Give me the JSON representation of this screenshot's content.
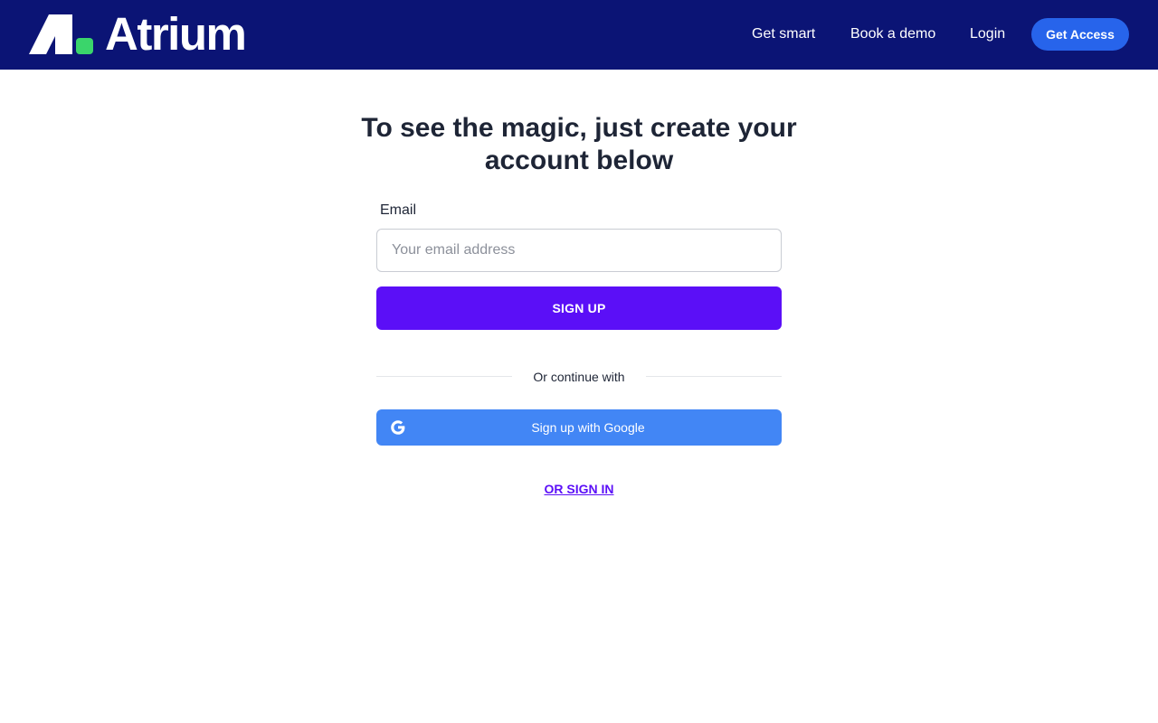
{
  "header": {
    "brand_name": "Atrium",
    "nav": {
      "get_smart": "Get smart",
      "book_demo": "Book a demo",
      "login": "Login"
    },
    "cta_label": "Get Access"
  },
  "main": {
    "headline": "To see the magic, just create your account below",
    "email_label": "Email",
    "email_placeholder": "Your email address",
    "email_value": "",
    "signup_label": "SIGN UP",
    "divider_text": "Or continue with",
    "google_label": "Sign up with Google",
    "signin_label": "OR SIGN IN"
  },
  "icons": {
    "logo": "atrium-logo-mark",
    "google": "google-g-icon"
  },
  "colors": {
    "header_bg": "#0b1475",
    "logo_accent": "#3ad56b",
    "cta_bg": "#2764eb",
    "signup_bg": "#5b0ff7",
    "google_bg": "#4286f5",
    "signin_link": "#5b0ff7",
    "heading_text": "#1e2536"
  }
}
